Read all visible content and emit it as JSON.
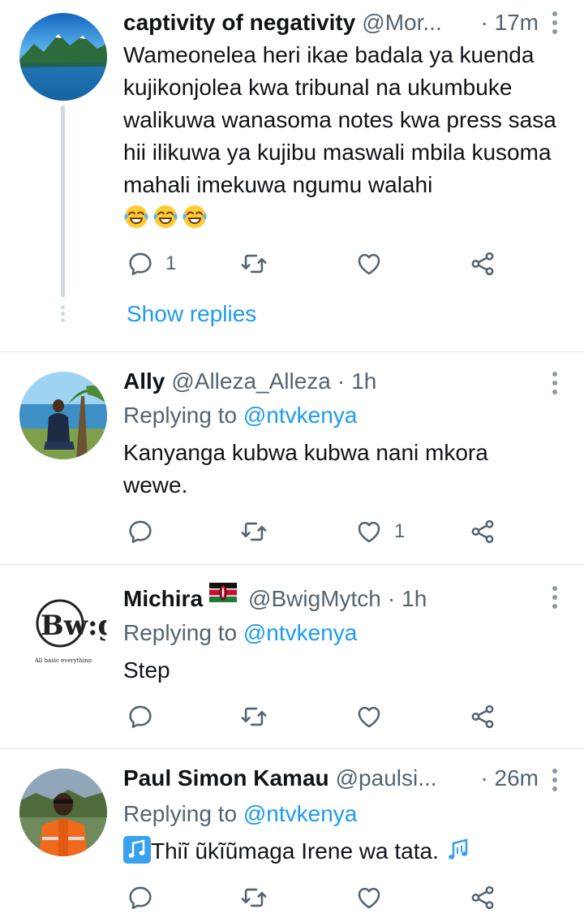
{
  "tweets": [
    {
      "name": "captivity of negativity",
      "handle": "@Mor...",
      "sep": "·",
      "time": "17m",
      "body": "Wameonelea heri ikae badala ya kuenda kujikonjolea kwa tribunal na ukumbuke walikuwa wanasoma notes kwa press sasa hii ilikuwa ya kujibu maswali mbila kusoma mahali imekuwa ngumu walahi",
      "emoji": [
        "face-with-tears-of-joy-emoji",
        "face-with-tears-of-joy-emoji",
        "face-with-tears-of-joy-emoji"
      ],
      "reply_count": "1",
      "retweet_count": "",
      "like_count": "",
      "show_replies": "Show replies"
    },
    {
      "name": "Ally",
      "handle": "@Alleza_Alleza",
      "sep": "·",
      "time": "1h",
      "replying_prefix": "Replying to",
      "replying_mention": "@ntvkenya",
      "body": "Kanyanga kubwa kubwa nani mkora wewe.",
      "reply_count": "",
      "retweet_count": "",
      "like_count": "1"
    },
    {
      "name": "Michira",
      "flag": "kenya-flag-emoji",
      "handle": "@BwigMytch",
      "sep": "·",
      "time": "1h",
      "replying_prefix": "Replying to",
      "replying_mention": "@ntvkenya",
      "body": "Step",
      "avatar_text": "Bw:g",
      "avatar_caption": "All basic everything"
    },
    {
      "name": "Paul Simon Kamau",
      "handle": "@paulsi...",
      "sep": "·",
      "time": "26m",
      "replying_prefix": "Replying to",
      "replying_mention": "@ntvkenya",
      "body": "Thiĩ ũkĩũmaga Irene wa tata.",
      "body_icons": [
        "musical-note-emoji",
        "musical-notes-emoji"
      ]
    }
  ],
  "icons": {
    "reply": "reply-icon",
    "retweet": "retweet-icon",
    "like": "like-icon",
    "share": "share-icon",
    "more": "more-options-icon"
  },
  "colors": {
    "accent": "#1d9bf0",
    "secondary_text": "#536471",
    "thread_line": "#cfd9de"
  }
}
